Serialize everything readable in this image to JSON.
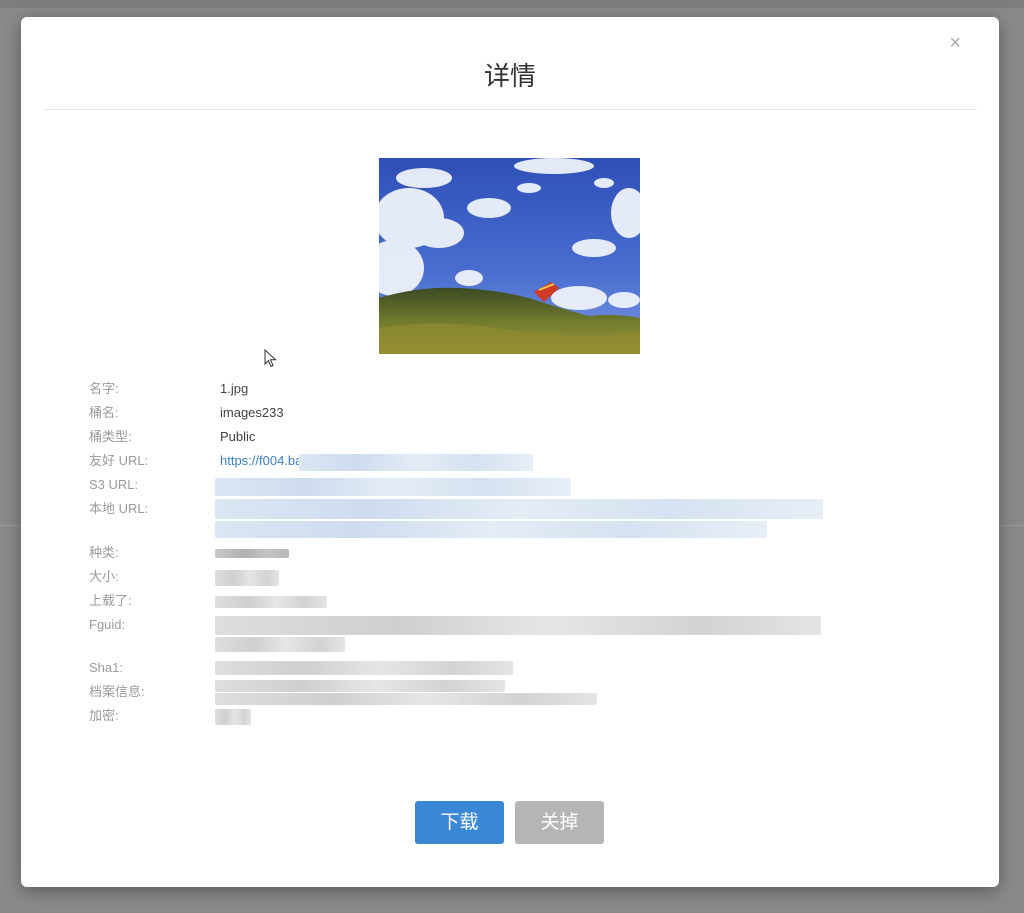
{
  "modal": {
    "title": "详情",
    "close_symbol": "×"
  },
  "details": [
    {
      "key": "name",
      "label": "名字:",
      "value": "1.jpg"
    },
    {
      "key": "bucket",
      "label": "桶名:",
      "value": "images233"
    },
    {
      "key": "bucket_type",
      "label": "桶类型:",
      "value": "Public"
    },
    {
      "key": "friendly_url",
      "label": "友好 URL:",
      "value": "https://f004.bacl"
    },
    {
      "key": "s3_url",
      "label": "S3 URL:",
      "value": ""
    },
    {
      "key": "local_url",
      "label": "本地 URL:",
      "value": ""
    },
    {
      "key": "type",
      "label": "种类:",
      "value": ""
    },
    {
      "key": "size",
      "label": "大小:",
      "value": ""
    },
    {
      "key": "uploaded",
      "label": "上载了:",
      "value": ""
    },
    {
      "key": "fguid",
      "label": "Fguid:",
      "value": ""
    },
    {
      "key": "sha1",
      "label": "Sha1:",
      "value": ""
    },
    {
      "key": "file_info",
      "label": "档案信息:",
      "value": ""
    },
    {
      "key": "encryption",
      "label": "加密:",
      "value": ""
    }
  ],
  "buttons": {
    "download": "下载",
    "close": "关掉"
  },
  "colors": {
    "primary": "#3a87d6",
    "secondary": "#b5b5b5",
    "link": "#3b82c4"
  }
}
